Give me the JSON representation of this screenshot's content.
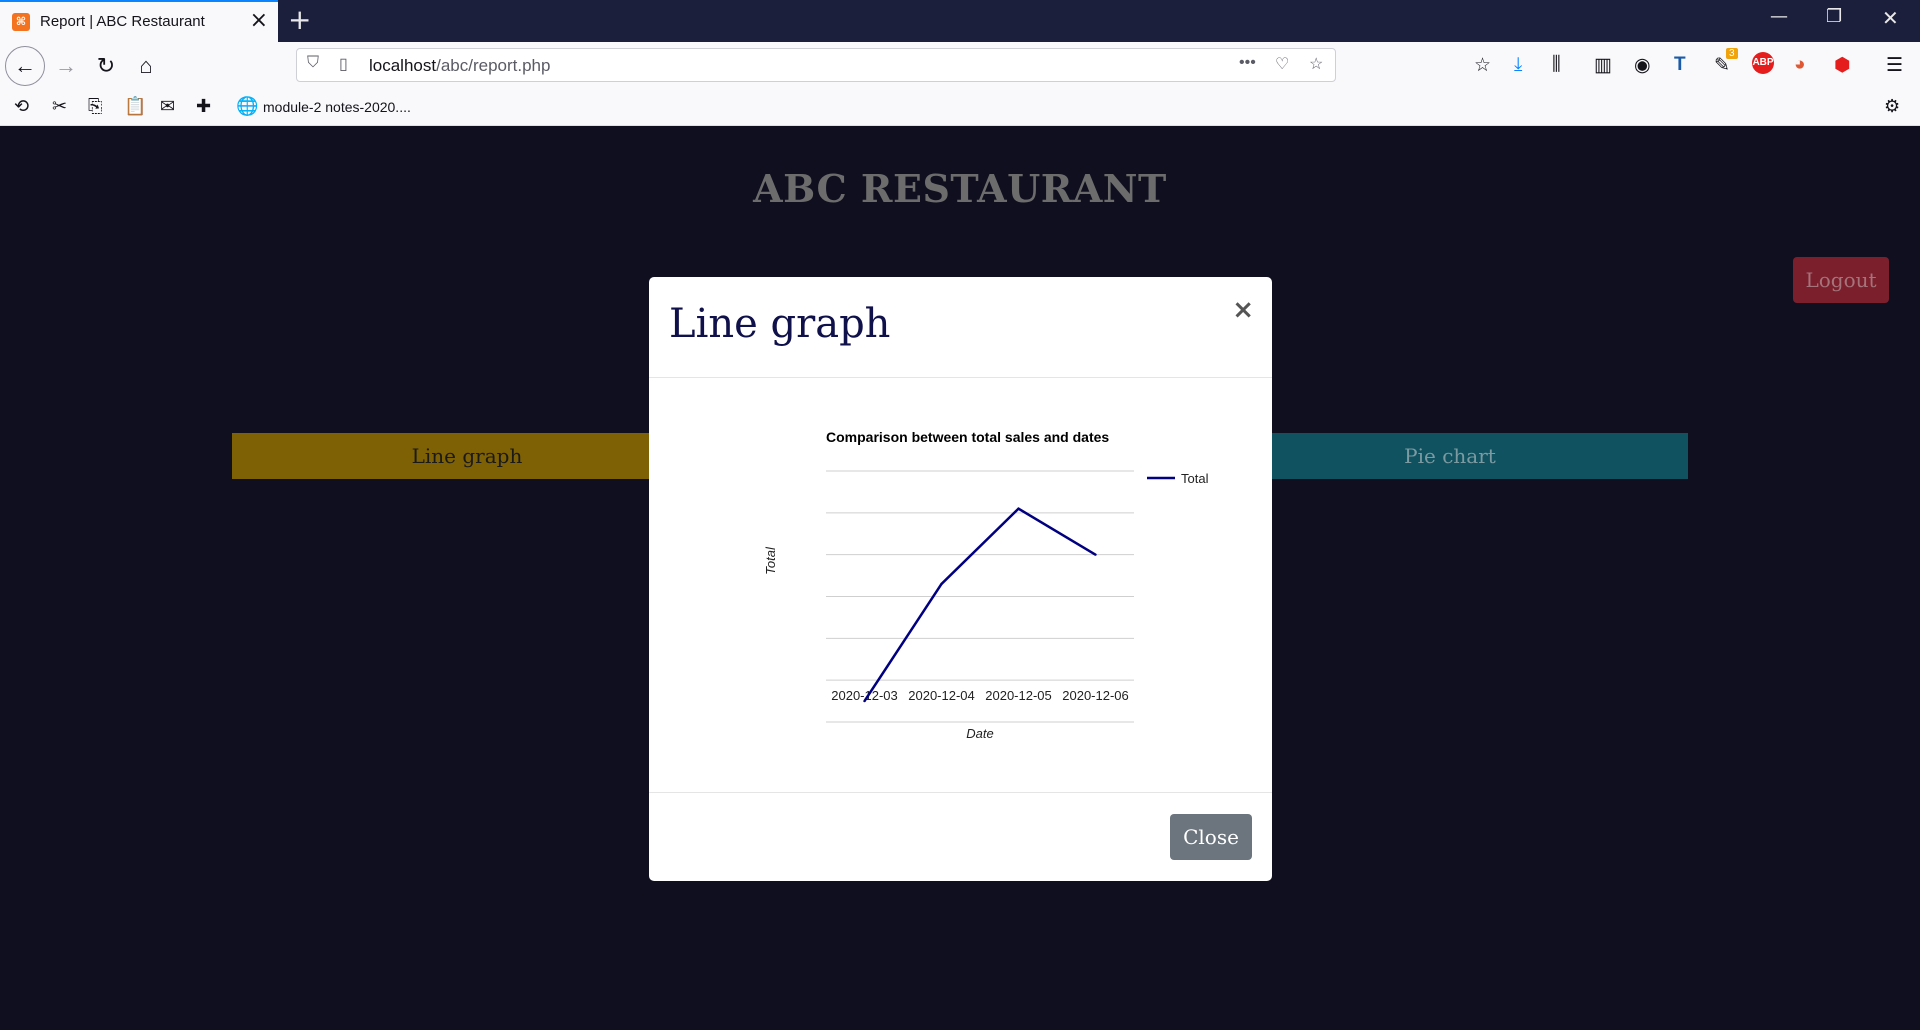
{
  "browser": {
    "tab_title": "Report | ABC Restaurant",
    "url_host": "localhost",
    "url_path": "/abc/report.php",
    "bookmark_label": "module-2 notes-2020....",
    "notification_badge": "3"
  },
  "page": {
    "brand": "ABC RESTAURANT",
    "logout_label": "Logout",
    "line_graph_label": "Line graph",
    "pie_chart_label": "Pie chart"
  },
  "modal": {
    "title": "Line graph",
    "close_x": "×",
    "close_label": "Close"
  },
  "chart_data": {
    "type": "line",
    "title": "Comparison between total sales and dates",
    "xlabel": "Date",
    "ylabel": "Total",
    "categories": [
      "2020-12-03",
      "2020-12-04",
      "2020-12-05",
      "2020-12-06"
    ],
    "series": [
      {
        "name": "Total",
        "values": [
          0.5,
          3.3,
          5.1,
          4.0
        ],
        "color": "#000080"
      }
    ],
    "ylim": [
      0,
      6
    ],
    "y_ticks_shown": false,
    "grid": true,
    "legend": "right"
  }
}
